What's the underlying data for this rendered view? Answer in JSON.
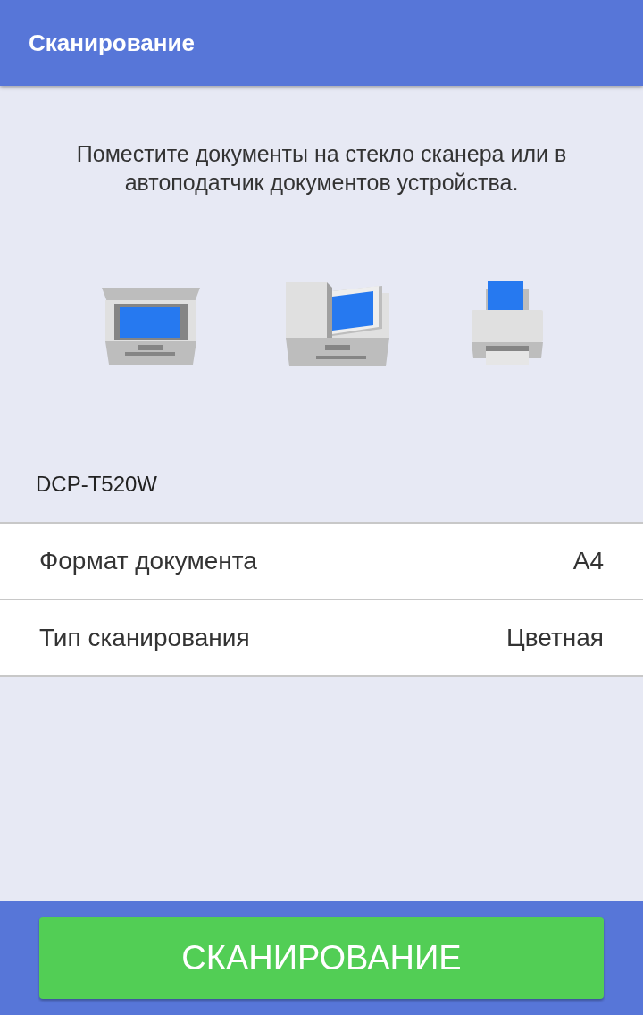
{
  "app_bar": {
    "title": "Сканирование"
  },
  "instruction": "Поместите документы на стекло сканера или в автоподатчик документов устройства.",
  "device": "DCP-T520W",
  "settings": [
    {
      "label": "Формат документа",
      "value": "A4"
    },
    {
      "label": "Тип сканирования",
      "value": "Цветная"
    }
  ],
  "scan_button": "СКАНИРОВАНИЕ"
}
